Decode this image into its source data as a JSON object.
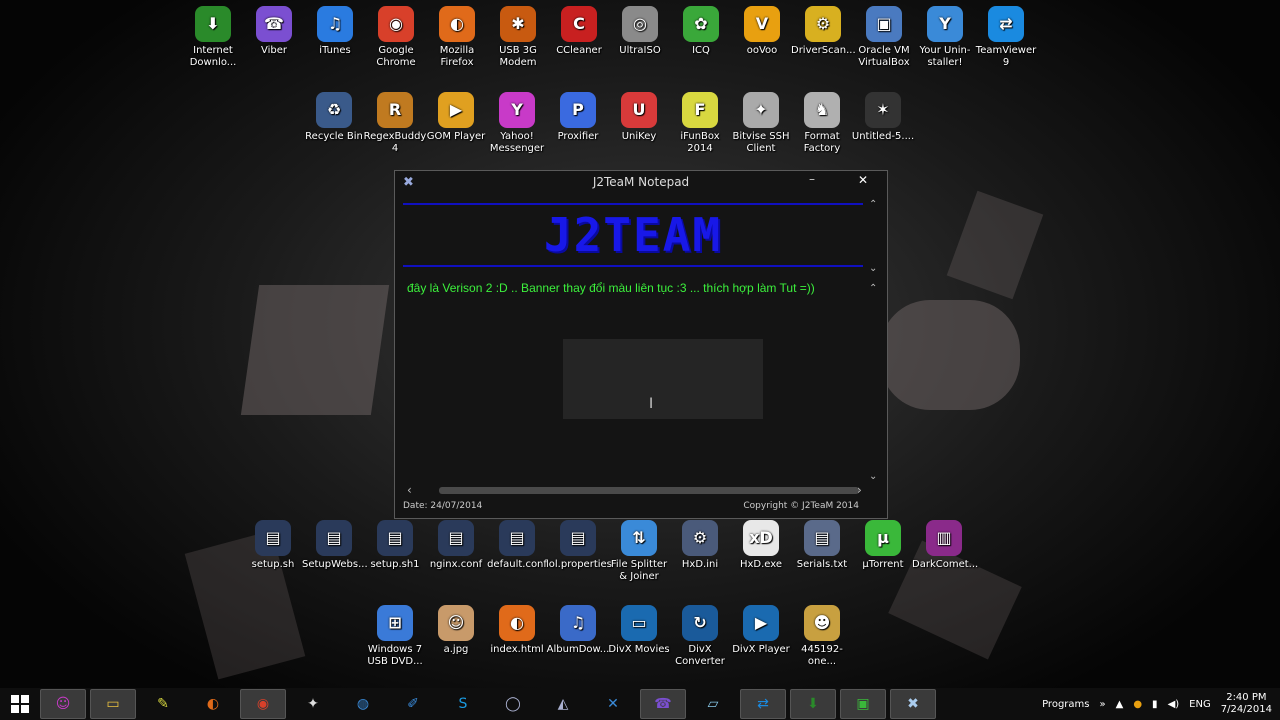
{
  "desktop": {
    "row1": [
      {
        "label": "Internet Downlo...",
        "icon": "idm-icon",
        "color": "#2a8a2a",
        "glyph": "⬇"
      },
      {
        "label": "Viber",
        "icon": "viber-icon",
        "color": "#7b4fd1",
        "glyph": "☎"
      },
      {
        "label": "iTunes",
        "icon": "itunes-icon",
        "color": "#2a7be0",
        "glyph": "♫"
      },
      {
        "label": "Google Chrome",
        "icon": "chrome-icon",
        "color": "#d8402a",
        "glyph": "◉"
      },
      {
        "label": "Mozilla Firefox",
        "icon": "firefox-icon",
        "color": "#e06a1a",
        "glyph": "◐"
      },
      {
        "label": "USB 3G Modem",
        "icon": "usb-modem-icon",
        "color": "#c85a10",
        "glyph": "✱"
      },
      {
        "label": "CCleaner",
        "icon": "ccleaner-icon",
        "color": "#c82020",
        "glyph": "C"
      },
      {
        "label": "UltraISO",
        "icon": "ultraiso-icon",
        "color": "#8a8a8a",
        "glyph": "◎"
      },
      {
        "label": "ICQ",
        "icon": "icq-icon",
        "color": "#3aa83a",
        "glyph": "✿"
      },
      {
        "label": "ooVoo",
        "icon": "oovoo-icon",
        "color": "#e8a010",
        "glyph": "V"
      },
      {
        "label": "DriverScan...",
        "icon": "driverscanner-icon",
        "color": "#d8b020",
        "glyph": "⚙"
      },
      {
        "label": "Oracle VM VirtualBox",
        "icon": "virtualbox-icon",
        "color": "#4a7ac0",
        "glyph": "▣"
      },
      {
        "label": "Your Unin-staller!",
        "icon": "uninstaller-icon",
        "color": "#3a8ad8",
        "glyph": "Y"
      },
      {
        "label": "TeamViewer 9",
        "icon": "teamviewer-icon",
        "color": "#1a8ae0",
        "glyph": "⇄"
      }
    ],
    "row2": [
      {
        "label": "Recycle Bin",
        "icon": "recycle-bin-icon",
        "color": "#3a5a8a",
        "glyph": "♻"
      },
      {
        "label": "RegexBuddy 4",
        "icon": "regexbuddy-icon",
        "color": "#c07a20",
        "glyph": "R"
      },
      {
        "label": "GOM Player",
        "icon": "gom-player-icon",
        "color": "#e0a020",
        "glyph": "▶"
      },
      {
        "label": "Yahoo! Messenger",
        "icon": "yahoo-messenger-icon",
        "color": "#c83ac8",
        "glyph": "Y"
      },
      {
        "label": "Proxifier",
        "icon": "proxifier-icon",
        "color": "#3a6ae0",
        "glyph": "P"
      },
      {
        "label": "UniKey",
        "icon": "unikey-icon",
        "color": "#d83a3a",
        "glyph": "U"
      },
      {
        "label": "iFunBox 2014",
        "icon": "ifunbox-icon",
        "color": "#d8d840",
        "glyph": "F"
      },
      {
        "label": "Bitvise SSH Client",
        "icon": "bitvise-icon",
        "color": "#aaaaaa",
        "glyph": "✦"
      },
      {
        "label": "Format Factory",
        "icon": "format-factory-icon",
        "color": "#b0b0b0",
        "glyph": "♞"
      },
      {
        "label": "Untitled-5....",
        "icon": "image-file-icon",
        "color": "#333333",
        "glyph": "✶"
      }
    ],
    "row3": [
      {
        "label": "setup.sh",
        "icon": "script-file-icon",
        "color": "#2a3a5a",
        "glyph": "▤"
      },
      {
        "label": "SetupWebs...",
        "icon": "script-file-icon",
        "color": "#2a3a5a",
        "glyph": "▤"
      },
      {
        "label": "setup.sh1",
        "icon": "script-file-icon",
        "color": "#2a3a5a",
        "glyph": "▤"
      },
      {
        "label": "nginx.conf",
        "icon": "config-file-icon",
        "color": "#2a3a5a",
        "glyph": "▤"
      },
      {
        "label": "default.conf",
        "icon": "config-file-icon",
        "color": "#2a3a5a",
        "glyph": "▤"
      },
      {
        "label": "lol.properties",
        "icon": "config-file-icon",
        "color": "#2a3a5a",
        "glyph": "▤"
      },
      {
        "label": "File Splitter & Joiner",
        "icon": "file-splitter-icon",
        "color": "#3a8ad8",
        "glyph": "⇅"
      },
      {
        "label": "HxD.ini",
        "icon": "ini-file-icon",
        "color": "#4a5a7a",
        "glyph": "⚙"
      },
      {
        "label": "HxD.exe",
        "icon": "hxd-icon",
        "color": "#e8e8e8",
        "glyph": "xD"
      },
      {
        "label": "Serials.txt",
        "icon": "text-file-icon",
        "color": "#5a6a8a",
        "glyph": "▤"
      },
      {
        "label": "µTorrent",
        "icon": "utorrent-icon",
        "color": "#3ab83a",
        "glyph": "µ"
      },
      {
        "label": "DarkComet...",
        "icon": "winrar-icon",
        "color": "#8a2a8a",
        "glyph": "▥"
      }
    ],
    "row4": [
      {
        "label": "Windows 7 USB DVD...",
        "icon": "windows-usb-icon",
        "color": "#3a7ad8",
        "glyph": "⊞"
      },
      {
        "label": "a.jpg",
        "icon": "jpg-file-icon",
        "color": "#c89a6a",
        "glyph": "☺"
      },
      {
        "label": "index.html",
        "icon": "html-file-icon",
        "color": "#e06a1a",
        "glyph": "◐"
      },
      {
        "label": "AlbumDow...",
        "icon": "album-downloader-icon",
        "color": "#3a6ac8",
        "glyph": "♫"
      },
      {
        "label": "DivX Movies",
        "icon": "divx-movies-icon",
        "color": "#1a6ab0",
        "glyph": "▭"
      },
      {
        "label": "DivX Converter",
        "icon": "divx-converter-icon",
        "color": "#1a5a9a",
        "glyph": "↻"
      },
      {
        "label": "DivX Player",
        "icon": "divx-player-icon",
        "color": "#1a6ab0",
        "glyph": "▶"
      },
      {
        "label": "445192-one...",
        "icon": "image-file-icon",
        "color": "#c8a040",
        "glyph": "☻"
      }
    ]
  },
  "window": {
    "title": "J2TeaM Notepad",
    "banner": "J2TEAM",
    "editor_text": "đây là Verison 2 :D .. Banner thay đổi màu liên tục :3 ... thích hợp làm Tut =))",
    "date": "Date: 24/07/2014",
    "copyright": "Copyright © J2TeaM 2014",
    "minimize_glyph": "–",
    "close_glyph": "✕",
    "app_glyph": "✖",
    "up_arrow": "⌃",
    "down_arrow": "⌄",
    "left_arrow": "‹",
    "right_arrow": "›"
  },
  "taskbar": {
    "start_icon": "windows-start-icon",
    "buttons": [
      {
        "icon": "yahoo-messenger-icon",
        "glyph": "☺",
        "color": "#c83ac8",
        "active": true
      },
      {
        "icon": "file-explorer-icon",
        "glyph": "▭",
        "color": "#e8c040",
        "active": true
      },
      {
        "icon": "notepad-icon",
        "glyph": "✎",
        "color": "#d8d840",
        "active": false
      },
      {
        "icon": "firefox-icon",
        "glyph": "◐",
        "color": "#e06a1a",
        "active": false
      },
      {
        "icon": "chrome-icon",
        "glyph": "◉",
        "color": "#d8402a",
        "active": true
      },
      {
        "icon": "bitvise-icon",
        "glyph": "✦",
        "color": "#dddddd",
        "active": false
      },
      {
        "icon": "globe-icon",
        "glyph": "◍",
        "color": "#3a8ad8",
        "active": false
      },
      {
        "icon": "paint-icon",
        "glyph": "✐",
        "color": "#3a8ad8",
        "active": false
      },
      {
        "icon": "skype-icon",
        "glyph": "S",
        "color": "#1a9ae0",
        "active": false
      },
      {
        "icon": "app-circle-icon",
        "glyph": "◯",
        "color": "#aab0d0",
        "active": false
      },
      {
        "icon": "network-icon",
        "glyph": "◭",
        "color": "#aab0d0",
        "active": false
      },
      {
        "icon": "tools-icon",
        "glyph": "✕",
        "color": "#3a8ad8",
        "active": false
      },
      {
        "icon": "viber-icon",
        "glyph": "☎",
        "color": "#7b4fd1",
        "active": true
      },
      {
        "icon": "window-icon",
        "glyph": "▱",
        "color": "#88c8e8",
        "active": false
      },
      {
        "icon": "teamviewer-icon",
        "glyph": "⇄",
        "color": "#1a8ae0",
        "active": true
      },
      {
        "icon": "idm-icon",
        "glyph": "⬇",
        "color": "#2a8a2a",
        "active": true
      },
      {
        "icon": "monitor-icon",
        "glyph": "▣",
        "color": "#3ab83a",
        "active": true
      },
      {
        "icon": "j2team-notepad-icon",
        "glyph": "✖",
        "color": "#aaccee",
        "active": true
      }
    ],
    "tray": {
      "programs_label": "Programs",
      "expand_glyph": "»",
      "up_glyph": "▲",
      "language": "ENG",
      "time": "2:40 PM",
      "date": "7/24/2014"
    }
  }
}
